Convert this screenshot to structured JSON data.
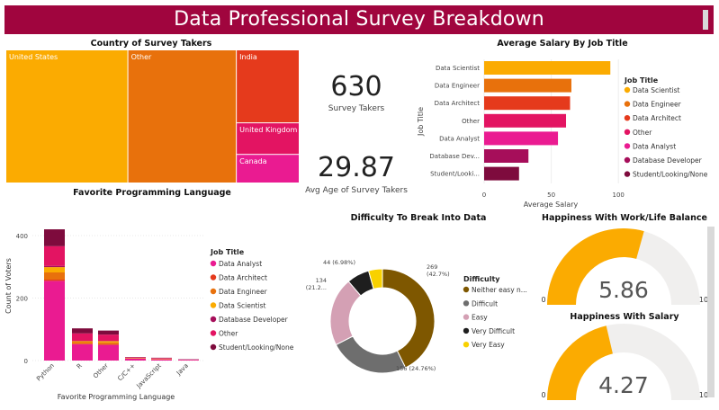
{
  "banner": {
    "title": "Data Professional Survey Breakdown"
  },
  "colors": {
    "banner": "#a0053e",
    "Data Scientist": "#fbab01",
    "Data Engineer": "#e8710c",
    "Data Architect": "#e53a1c",
    "Other": "#e31462",
    "Data Analyst": "#ea1b91",
    "Database Developer": "#a60e5a",
    "Student/Looking/None": "#7e0b3d",
    "gauge_fill": "#fbab01",
    "gauge_track": "#f0efee"
  },
  "kpis": {
    "survey_takers": {
      "value": "630",
      "label": "Survey Takers"
    },
    "avg_age": {
      "value": "29.87",
      "label": "Avg Age of Survey Takers"
    }
  },
  "chart_data": [
    {
      "type": "treemap",
      "title": "Country of Survey Takers",
      "categories": [
        "United States",
        "Other",
        "India",
        "United Kingdom",
        "Canada"
      ],
      "values": [
        262,
        233,
        74,
        32,
        29
      ],
      "colors": [
        "#fbab01",
        "#e8710c",
        "#e53a1c",
        "#e31462",
        "#ea1b91"
      ]
    },
    {
      "type": "bar",
      "orientation": "horizontal",
      "title": "Average Salary By Job Title",
      "categories": [
        "Data Scientist",
        "Data Engineer",
        "Data Architect",
        "Other",
        "Data Analyst",
        "Database Dev...",
        "Student/Looki..."
      ],
      "values": [
        94,
        65,
        64,
        61,
        55,
        33,
        26
      ],
      "xlabel": "Average Salary",
      "ylabel": "Job Title",
      "xticks": [
        "0",
        "50",
        "100"
      ],
      "xlim": [
        0,
        100
      ],
      "legend": {
        "title": "Job Title",
        "position": "right",
        "items": [
          "Data Scientist",
          "Data Engineer",
          "Data Architect",
          "Other",
          "Data Analyst",
          "Database Developer",
          "Student/Looking/None"
        ]
      }
    },
    {
      "type": "bar",
      "stacked": true,
      "title": "Favorite Programming Language",
      "categories": [
        "Python",
        "R",
        "Other",
        "C/C++",
        "JavaScript",
        "Java"
      ],
      "xlabel": "Favorite Programming Language",
      "ylabel": "Count of Voters",
      "ylim": [
        0,
        420
      ],
      "yticks": [
        "0",
        "200",
        "400"
      ],
      "series": [
        {
          "name": "Data Analyst",
          "values": [
            255,
            52,
            50,
            6,
            4,
            2
          ]
        },
        {
          "name": "Data Architect",
          "values": [
            4,
            2,
            2,
            0,
            0,
            0
          ]
        },
        {
          "name": "Data Engineer",
          "values": [
            23,
            5,
            6,
            1,
            1,
            0
          ]
        },
        {
          "name": "Data Scientist",
          "values": [
            17,
            3,
            4,
            1,
            1,
            0
          ]
        },
        {
          "name": "Database Developer",
          "values": [
            4,
            1,
            1,
            0,
            0,
            0
          ]
        },
        {
          "name": "Other",
          "values": [
            63,
            24,
            20,
            2,
            2,
            1
          ]
        },
        {
          "name": "Student/Looking/None",
          "values": [
            54,
            16,
            13,
            1,
            1,
            1
          ]
        }
      ],
      "legend": {
        "title": "Job Title",
        "position": "right"
      }
    },
    {
      "type": "pie",
      "donut": true,
      "title": "Difficulty To Break Into Data",
      "categories": [
        "Neither easy nor difficult",
        "Difficult",
        "Easy",
        "Very Difficult",
        "Very Easy"
      ],
      "values": [
        269,
        156,
        134,
        44,
        27
      ],
      "colors": [
        "#7e5700",
        "#6e6e6e",
        "#d4a0b4",
        "#1e1e1e",
        "#f8d100"
      ],
      "data_labels": [
        "269\n(42.7%)",
        "156 (24.76%)",
        "134\n(21.2...",
        "44 (6.98%)"
      ],
      "legend": {
        "title": "Difficulty",
        "position": "right",
        "items": [
          "Neither easy n...",
          "Difficult",
          "Easy",
          "Very Difficult",
          "Very Easy"
        ]
      }
    },
    {
      "type": "gauge",
      "title": "Happiness With Work/Life Balance",
      "value": 5.86,
      "value_label": "5.86",
      "min": 0,
      "max": 10,
      "min_label": "0",
      "max_label": "10"
    },
    {
      "type": "gauge",
      "title": "Happiness With Salary",
      "value": 4.27,
      "value_label": "4.27",
      "min": 0,
      "max": 10,
      "min_label": "0",
      "max_label": "10"
    }
  ]
}
